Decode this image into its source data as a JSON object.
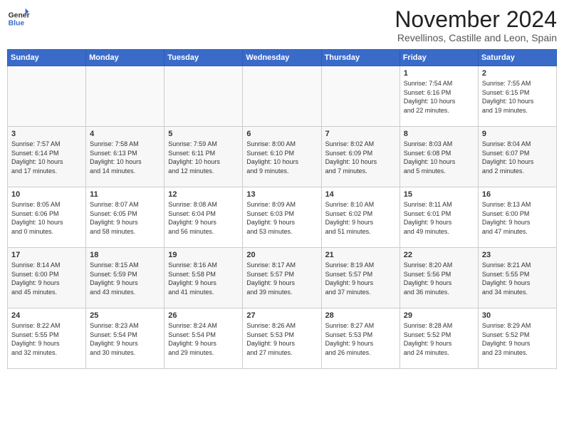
{
  "header": {
    "logo_line1": "General",
    "logo_line2": "Blue",
    "month": "November 2024",
    "location": "Revellinos, Castille and Leon, Spain"
  },
  "weekdays": [
    "Sunday",
    "Monday",
    "Tuesday",
    "Wednesday",
    "Thursday",
    "Friday",
    "Saturday"
  ],
  "weeks": [
    [
      {
        "day": "",
        "info": ""
      },
      {
        "day": "",
        "info": ""
      },
      {
        "day": "",
        "info": ""
      },
      {
        "day": "",
        "info": ""
      },
      {
        "day": "",
        "info": ""
      },
      {
        "day": "1",
        "info": "Sunrise: 7:54 AM\nSunset: 6:16 PM\nDaylight: 10 hours\nand 22 minutes."
      },
      {
        "day": "2",
        "info": "Sunrise: 7:55 AM\nSunset: 6:15 PM\nDaylight: 10 hours\nand 19 minutes."
      }
    ],
    [
      {
        "day": "3",
        "info": "Sunrise: 7:57 AM\nSunset: 6:14 PM\nDaylight: 10 hours\nand 17 minutes."
      },
      {
        "day": "4",
        "info": "Sunrise: 7:58 AM\nSunset: 6:13 PM\nDaylight: 10 hours\nand 14 minutes."
      },
      {
        "day": "5",
        "info": "Sunrise: 7:59 AM\nSunset: 6:11 PM\nDaylight: 10 hours\nand 12 minutes."
      },
      {
        "day": "6",
        "info": "Sunrise: 8:00 AM\nSunset: 6:10 PM\nDaylight: 10 hours\nand 9 minutes."
      },
      {
        "day": "7",
        "info": "Sunrise: 8:02 AM\nSunset: 6:09 PM\nDaylight: 10 hours\nand 7 minutes."
      },
      {
        "day": "8",
        "info": "Sunrise: 8:03 AM\nSunset: 6:08 PM\nDaylight: 10 hours\nand 5 minutes."
      },
      {
        "day": "9",
        "info": "Sunrise: 8:04 AM\nSunset: 6:07 PM\nDaylight: 10 hours\nand 2 minutes."
      }
    ],
    [
      {
        "day": "10",
        "info": "Sunrise: 8:05 AM\nSunset: 6:06 PM\nDaylight: 10 hours\nand 0 minutes."
      },
      {
        "day": "11",
        "info": "Sunrise: 8:07 AM\nSunset: 6:05 PM\nDaylight: 9 hours\nand 58 minutes."
      },
      {
        "day": "12",
        "info": "Sunrise: 8:08 AM\nSunset: 6:04 PM\nDaylight: 9 hours\nand 56 minutes."
      },
      {
        "day": "13",
        "info": "Sunrise: 8:09 AM\nSunset: 6:03 PM\nDaylight: 9 hours\nand 53 minutes."
      },
      {
        "day": "14",
        "info": "Sunrise: 8:10 AM\nSunset: 6:02 PM\nDaylight: 9 hours\nand 51 minutes."
      },
      {
        "day": "15",
        "info": "Sunrise: 8:11 AM\nSunset: 6:01 PM\nDaylight: 9 hours\nand 49 minutes."
      },
      {
        "day": "16",
        "info": "Sunrise: 8:13 AM\nSunset: 6:00 PM\nDaylight: 9 hours\nand 47 minutes."
      }
    ],
    [
      {
        "day": "17",
        "info": "Sunrise: 8:14 AM\nSunset: 6:00 PM\nDaylight: 9 hours\nand 45 minutes."
      },
      {
        "day": "18",
        "info": "Sunrise: 8:15 AM\nSunset: 5:59 PM\nDaylight: 9 hours\nand 43 minutes."
      },
      {
        "day": "19",
        "info": "Sunrise: 8:16 AM\nSunset: 5:58 PM\nDaylight: 9 hours\nand 41 minutes."
      },
      {
        "day": "20",
        "info": "Sunrise: 8:17 AM\nSunset: 5:57 PM\nDaylight: 9 hours\nand 39 minutes."
      },
      {
        "day": "21",
        "info": "Sunrise: 8:19 AM\nSunset: 5:57 PM\nDaylight: 9 hours\nand 37 minutes."
      },
      {
        "day": "22",
        "info": "Sunrise: 8:20 AM\nSunset: 5:56 PM\nDaylight: 9 hours\nand 36 minutes."
      },
      {
        "day": "23",
        "info": "Sunrise: 8:21 AM\nSunset: 5:55 PM\nDaylight: 9 hours\nand 34 minutes."
      }
    ],
    [
      {
        "day": "24",
        "info": "Sunrise: 8:22 AM\nSunset: 5:55 PM\nDaylight: 9 hours\nand 32 minutes."
      },
      {
        "day": "25",
        "info": "Sunrise: 8:23 AM\nSunset: 5:54 PM\nDaylight: 9 hours\nand 30 minutes."
      },
      {
        "day": "26",
        "info": "Sunrise: 8:24 AM\nSunset: 5:54 PM\nDaylight: 9 hours\nand 29 minutes."
      },
      {
        "day": "27",
        "info": "Sunrise: 8:26 AM\nSunset: 5:53 PM\nDaylight: 9 hours\nand 27 minutes."
      },
      {
        "day": "28",
        "info": "Sunrise: 8:27 AM\nSunset: 5:53 PM\nDaylight: 9 hours\nand 26 minutes."
      },
      {
        "day": "29",
        "info": "Sunrise: 8:28 AM\nSunset: 5:52 PM\nDaylight: 9 hours\nand 24 minutes."
      },
      {
        "day": "30",
        "info": "Sunrise: 8:29 AM\nSunset: 5:52 PM\nDaylight: 9 hours\nand 23 minutes."
      }
    ]
  ]
}
